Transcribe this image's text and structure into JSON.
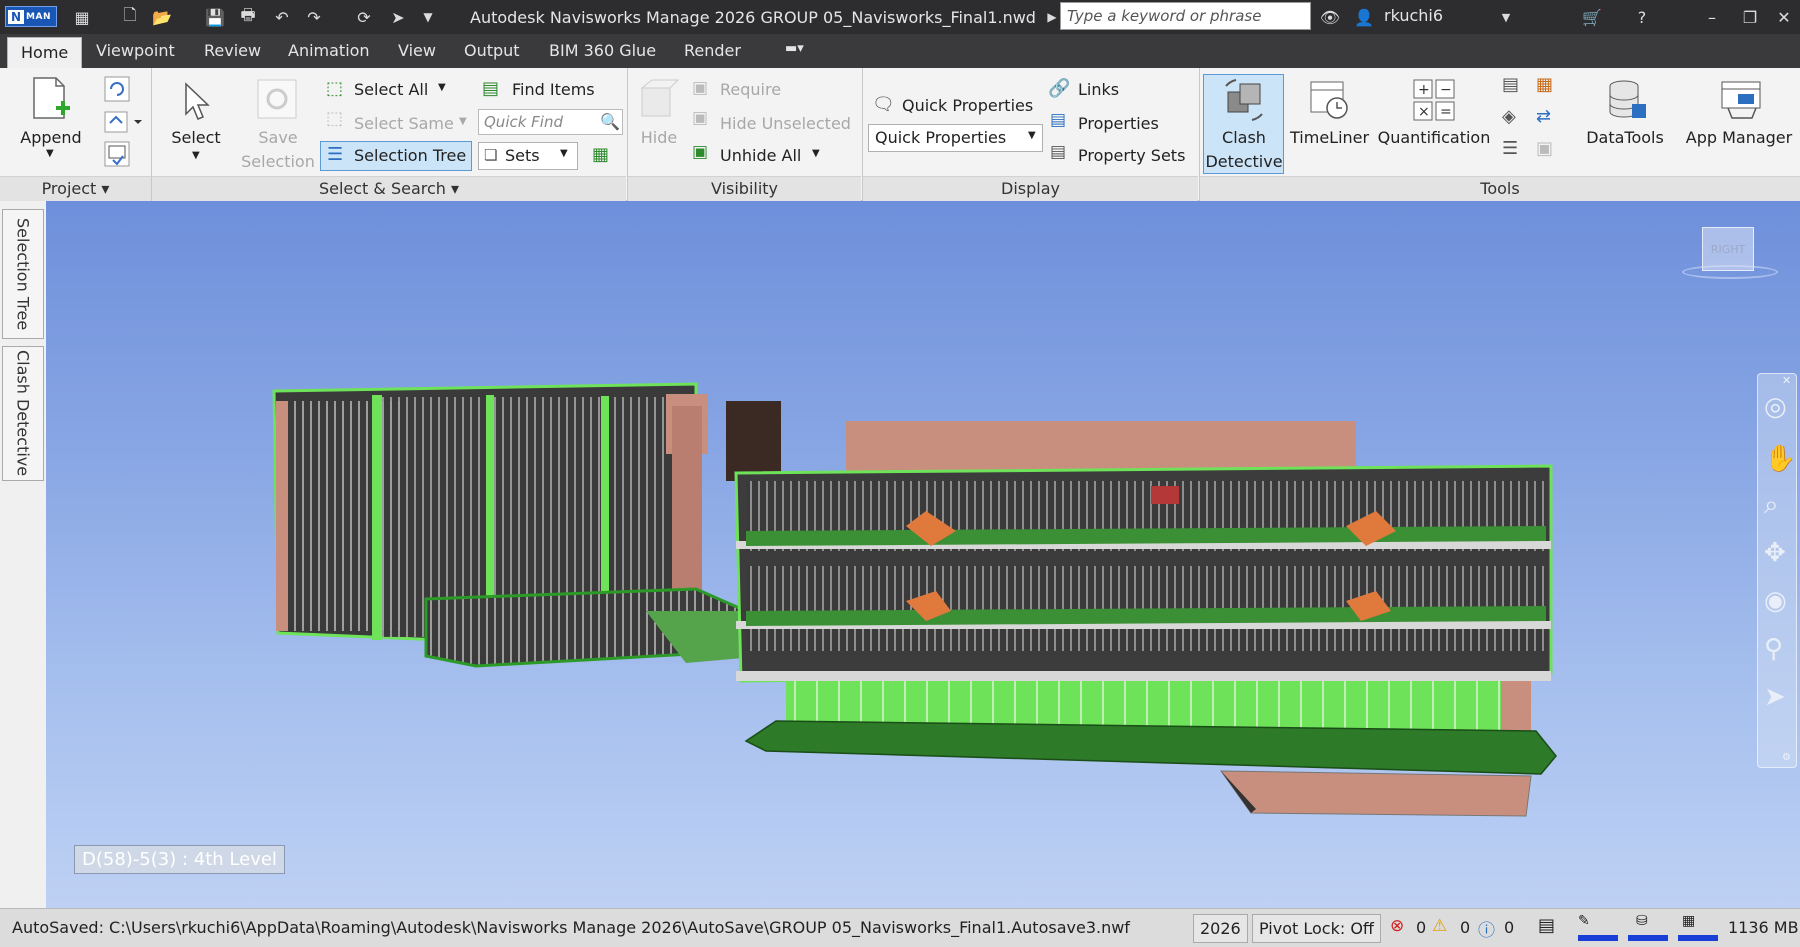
{
  "titlebar": {
    "app_badge": "MAN",
    "app_letter": "N",
    "title": "Autodesk Navisworks Manage 2026    GROUP 05_Navisworks_Final1.nwd",
    "search_placeholder": "Type a keyword or phrase",
    "user": "rkuchi6"
  },
  "tabs": [
    "Home",
    "Viewpoint",
    "Review",
    "Animation",
    "View",
    "Output",
    "BIM 360 Glue",
    "Render"
  ],
  "ribbon": {
    "project": {
      "append": "Append",
      "footer": "Project"
    },
    "select_search": {
      "select": "Select",
      "save_selection_1": "Save",
      "save_selection_2": "Selection",
      "select_all": "Select All",
      "select_same": "Select Same",
      "selection_tree": "Selection Tree",
      "find_items": "Find Items",
      "quick_find_placeholder": "Quick Find",
      "sets": "Sets",
      "footer": "Select & Search"
    },
    "visibility": {
      "hide": "Hide",
      "require": "Require",
      "hide_unselected": "Hide Unselected",
      "unhide_all": "Unhide All",
      "footer": "Visibility"
    },
    "display": {
      "quick_properties": "Quick Properties",
      "quick_properties_combo": "Quick Properties",
      "links": "Links",
      "properties": "Properties",
      "property_sets": "Property Sets",
      "footer": "Display"
    },
    "tools": {
      "clash_1": "Clash",
      "clash_2": "Detective",
      "timeliner": "TimeLiner",
      "quantification": "Quantification",
      "datatools": "DataTools",
      "app_manager": "App Manager",
      "footer": "Tools"
    }
  },
  "side_tabs": [
    "Selection Tree",
    "Clash Detective"
  ],
  "viewport": {
    "level_label": "D(58)-5(3) : 4th Level",
    "viewcube_face": "RIGHT"
  },
  "statusbar": {
    "autosave": "AutoSaved: C:\\Users\\rkuchi6\\AppData\\Roaming\\Autodesk\\Navisworks Manage 2026\\AutoSave\\GROUP 05_Navisworks_Final1.Autosave3.nwf",
    "year": "2026",
    "pivot": "Pivot Lock: Off",
    "errors": "0",
    "warnings": "0",
    "infos": "0",
    "memory": "1136 MB"
  },
  "colors": {
    "accent": "#1a57b5",
    "model_green": "#6ee35a",
    "model_brick": "#c98f7e"
  }
}
